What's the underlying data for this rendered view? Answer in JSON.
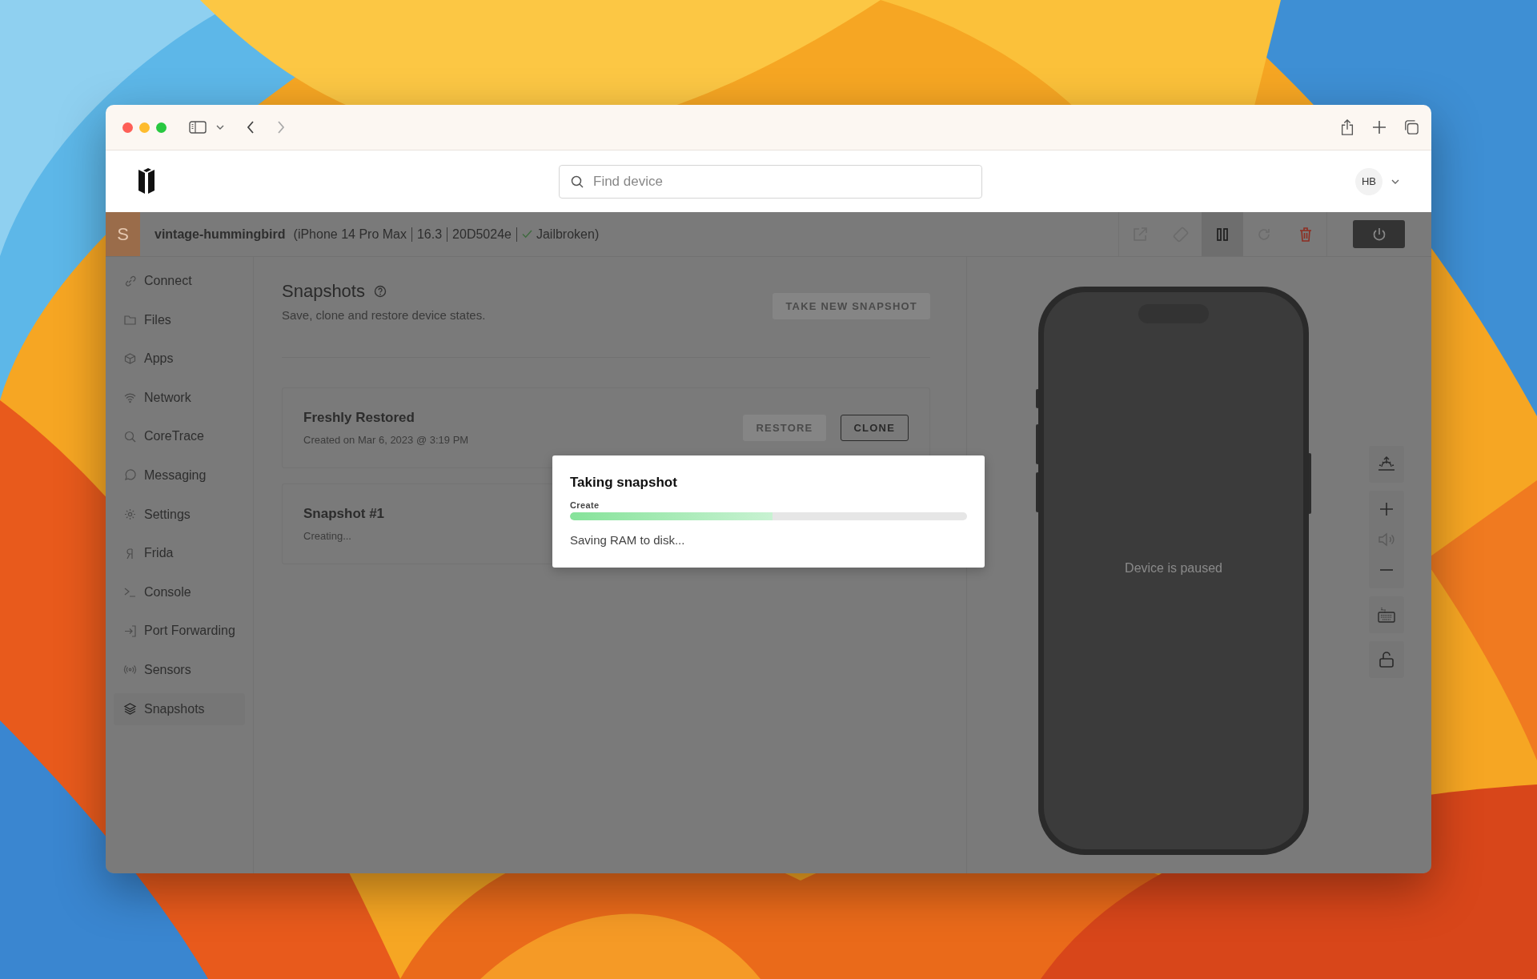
{
  "header": {
    "search": {
      "placeholder": "Find device"
    },
    "avatar": "HB"
  },
  "device": {
    "initial": "S",
    "name": "vintage-hummingbird",
    "details": [
      "(iPhone 14 Pro Max",
      "16.3",
      "20D5024e"
    ],
    "jailbroken": true,
    "status": "Jailbroken)",
    "paused": true
  },
  "sidebar": {
    "items": [
      {
        "label": "Connect",
        "selected": false
      },
      {
        "label": "Files",
        "selected": false
      },
      {
        "label": "Apps",
        "selected": false
      },
      {
        "label": "Network",
        "selected": false
      },
      {
        "label": "CoreTrace",
        "selected": false
      },
      {
        "label": "Messaging",
        "selected": false
      },
      {
        "label": "Settings",
        "selected": false
      },
      {
        "label": "Frida",
        "selected": false
      },
      {
        "label": "Console",
        "selected": false
      },
      {
        "label": "Port Forwarding",
        "selected": false
      },
      {
        "label": "Sensors",
        "selected": false
      },
      {
        "label": "Snapshots",
        "selected": true
      }
    ]
  },
  "page": {
    "title": "Snapshots",
    "subtitle": "Save, clone and restore device states.",
    "new_button": {
      "label": "TAKE NEW SNAPSHOT",
      "disabled": true
    },
    "snapshots": [
      {
        "name": "Freshly Restored",
        "detail": "Created on Mar 6, 2023 @ 3:19 PM",
        "actions": [
          {
            "label": "RESTORE",
            "disabled": true
          },
          {
            "label": "CLONE",
            "disabled": false
          }
        ]
      },
      {
        "name": "Snapshot #1",
        "detail": "Creating..."
      }
    ]
  },
  "modal": {
    "title": "Taking snapshot",
    "step": "Create",
    "level": 0.51,
    "message": "Saving RAM to disk..."
  },
  "phone": {
    "message": "Device is paused"
  }
}
